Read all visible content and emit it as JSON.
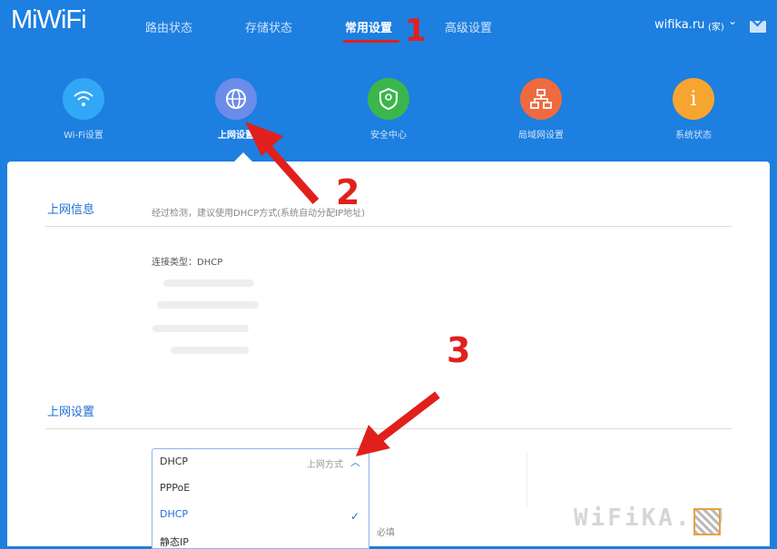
{
  "header": {
    "logo": "MiWiFi",
    "nav": [
      "路由状态",
      "存储状态",
      "常用设置",
      "高级设置"
    ],
    "active_nav": "常用设置",
    "domain": "wifika.ru",
    "lang": "(家)"
  },
  "icons": [
    {
      "label": "Wi-Fi设置",
      "color": "#31a8f5",
      "icon": "wifi-icon"
    },
    {
      "label": "上网设置",
      "color": "#6b8ce9",
      "icon": "globe-icon"
    },
    {
      "label": "安全中心",
      "color": "#3bb64c",
      "icon": "shield-icon"
    },
    {
      "label": "局域网设置",
      "color": "#ef6a3f",
      "icon": "network-icon"
    },
    {
      "label": "系统状态",
      "color": "#f7a531",
      "icon": "info-icon"
    }
  ],
  "annotations": [
    "1",
    "2",
    "3"
  ],
  "info": {
    "title": "上网信息",
    "hint": "经过检测，建议使用DHCP方式(系统自动分配IP地址)",
    "connection_type": "连接类型：DHCP"
  },
  "settings": {
    "title": "上网设置",
    "select_value": "DHCP",
    "select_hint": "上网方式",
    "options": [
      "PPPoE",
      "DHCP",
      "静态IP"
    ],
    "selected": "DHCP",
    "required": "必填"
  },
  "watermark": "WiFiKA.RU",
  "colors": {
    "brand": "#1d7fe0",
    "accent": "#e1201d",
    "link": "#1d6fd6"
  }
}
